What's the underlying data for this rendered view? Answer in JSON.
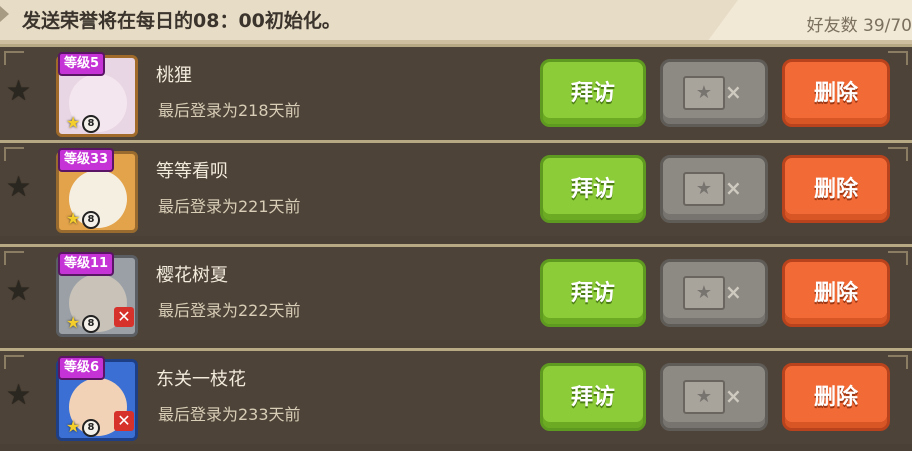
{
  "header": {
    "notice": "发送荣誉将在每日的08：00初始化。",
    "friend_count": "好友数 39/70"
  },
  "colors": {
    "visit_button": "#8ccc38",
    "delete_button": "#f26b37",
    "gift_button_disabled": "#8d8a84",
    "level_badge": "#c533d6"
  },
  "buttons": {
    "visit": "拜访",
    "delete": "删除",
    "gift_x": "×"
  },
  "friends": [
    {
      "level": "等级5",
      "name": "桃狸",
      "last_login": "最后登录为218天前",
      "rank": "8"
    },
    {
      "level": "等级33",
      "name": "等等看呗",
      "last_login": "最后登录为221天前",
      "rank": "8"
    },
    {
      "level": "等级11",
      "name": "樱花树夏",
      "last_login": "最后登录为222天前",
      "rank": "8"
    },
    {
      "level": "等级6",
      "name": "东关一枝花",
      "last_login": "最后登录为233天前",
      "rank": "8"
    }
  ]
}
